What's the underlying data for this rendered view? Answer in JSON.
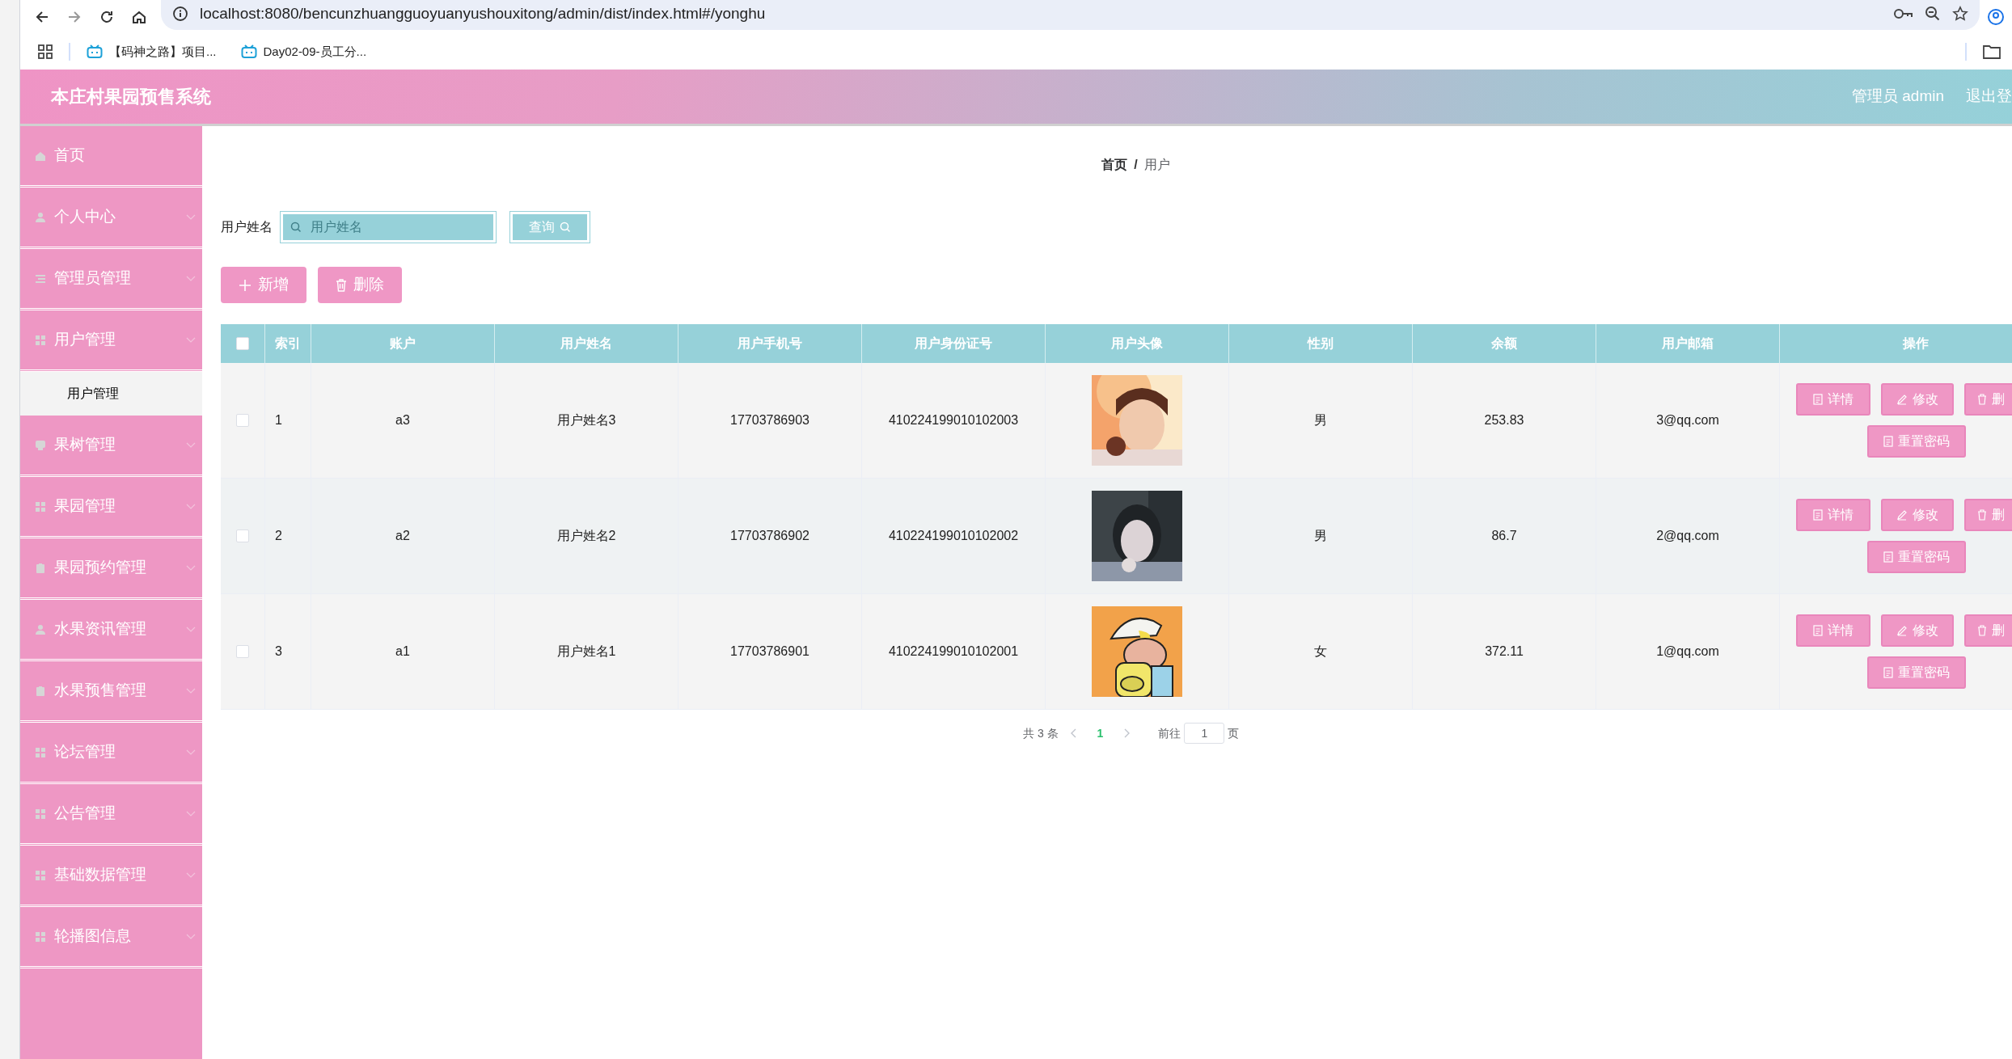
{
  "browser": {
    "url": "localhost:8080/bencunzhuangguoyuanyushouxitong/admin/dist/index.html#/yonghu",
    "bookmarks": [
      "【码神之路】项目...",
      "Day02-09-员工分..."
    ]
  },
  "header": {
    "title": "本庄村果园预售系统",
    "user": "管理员 admin",
    "logout": "退出登"
  },
  "sidebar": {
    "items": [
      {
        "kind": "link",
        "label": "首页"
      },
      {
        "kind": "menu",
        "label": "个人中心"
      },
      {
        "kind": "menu",
        "label": "管理员管理"
      },
      {
        "kind": "menu",
        "label": "用户管理",
        "children": [
          {
            "label": "用户管理"
          }
        ]
      },
      {
        "kind": "menu",
        "label": "果树管理"
      },
      {
        "kind": "menu",
        "label": "果园管理"
      },
      {
        "kind": "menu",
        "label": "果园预约管理"
      },
      {
        "kind": "menu",
        "label": "水果资讯管理"
      },
      {
        "kind": "menu",
        "label": "水果预售管理"
      },
      {
        "kind": "menu",
        "label": "论坛管理"
      },
      {
        "kind": "menu",
        "label": "公告管理"
      },
      {
        "kind": "menu",
        "label": "基础数据管理"
      },
      {
        "kind": "menu",
        "label": "轮播图信息"
      }
    ]
  },
  "breadcrumb": [
    "首页",
    "/",
    "用户"
  ],
  "search": {
    "label": "用户姓名",
    "placeholder": "用户姓名",
    "button": "查询"
  },
  "actions": [
    {
      "kind": "add",
      "label": "新增"
    },
    {
      "kind": "delete",
      "label": "删除"
    }
  ],
  "table": {
    "header_checked": false,
    "columns": [
      "索引",
      "账户",
      "用户姓名",
      "用户手机号",
      "用户身份证号",
      "用户头像",
      "性别",
      "余额",
      "用户邮箱",
      "操作"
    ],
    "rows": [
      {
        "checked": false,
        "cells": [
          "1",
          "a3",
          "用户姓名3",
          "17703786903",
          "410224199010102003",
          null,
          "男",
          "253.83",
          "3@qq.com"
        ],
        "buttons": [
          {
            "kind": "detail",
            "label": "详情"
          },
          {
            "kind": "edit",
            "label": "修改"
          },
          {
            "kind": "delete",
            "label": "删"
          },
          {
            "kind": "reset",
            "label": "重置密码"
          }
        ]
      },
      {
        "checked": false,
        "cells": [
          "2",
          "a2",
          "用户姓名2",
          "17703786902",
          "410224199010102002",
          null,
          "男",
          "86.7",
          "2@qq.com"
        ],
        "buttons": [
          {
            "kind": "detail",
            "label": "详情"
          },
          {
            "kind": "edit",
            "label": "修改"
          },
          {
            "kind": "delete",
            "label": "删"
          },
          {
            "kind": "reset",
            "label": "重置密码"
          }
        ]
      },
      {
        "checked": false,
        "cells": [
          "3",
          "a1",
          "用户姓名1",
          "17703786901",
          "410224199010102001",
          null,
          "女",
          "372.11",
          "1@qq.com"
        ],
        "buttons": [
          {
            "kind": "detail",
            "label": "详情"
          },
          {
            "kind": "edit",
            "label": "修改"
          },
          {
            "kind": "delete",
            "label": "删"
          },
          {
            "kind": "reset",
            "label": "重置密码"
          }
        ]
      }
    ]
  },
  "pagination": {
    "total": "共 3 条",
    "pages": [
      {
        "label": "1",
        "selected": true
      }
    ],
    "goto_label": "前往",
    "goto_value": "1",
    "unit": "页"
  }
}
